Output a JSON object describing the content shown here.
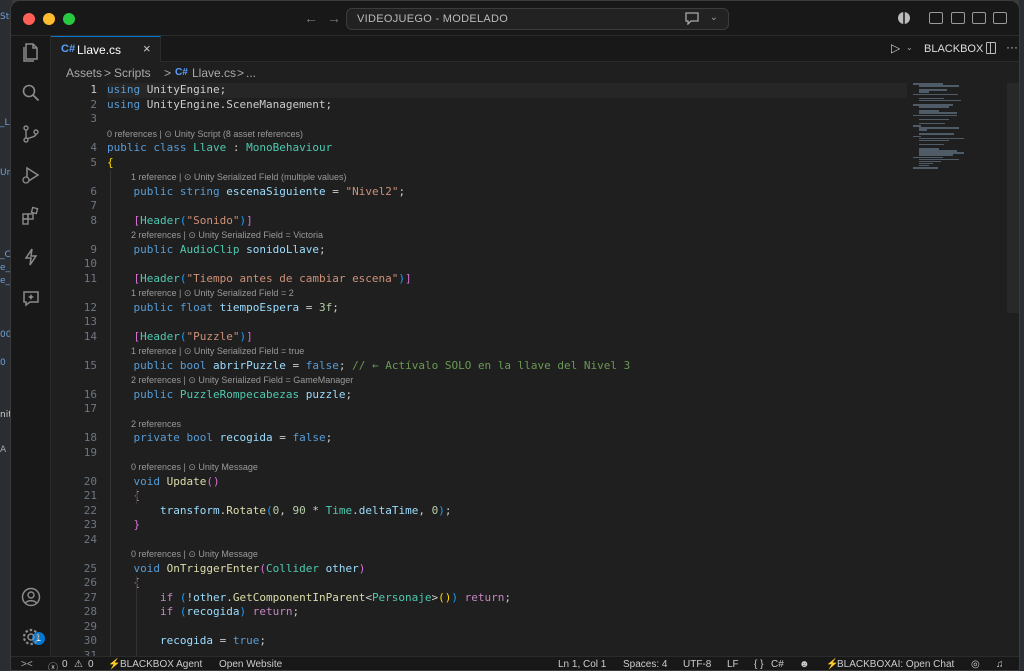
{
  "window": {
    "title": "VIDEOJUEGO - MODELADO",
    "bg_fragments": [
      "Ste",
      "_L",
      "Un",
      "_C",
      "e_1",
      "e_1",
      "00",
      "0",
      "nit",
      "A"
    ]
  },
  "tabs": [
    {
      "label": "Llave.cs",
      "icon": "C#",
      "close": "×"
    }
  ],
  "toolbar": {
    "blackbox_label": "BLACKBOX",
    "more": "···"
  },
  "breadcrumb": {
    "items": [
      "Assets",
      "Scripts",
      "Llave.cs",
      "..."
    ],
    "separator": ">",
    "file_icon": "C#"
  },
  "editor": {
    "lines": [
      {
        "n": "1",
        "html": "<span class=\"kw\">using</span> UnityEngine;"
      },
      {
        "n": "2",
        "html": "<span class=\"kw\">using</span> UnityEngine.SceneManagement;"
      },
      {
        "n": "3",
        "html": ""
      },
      {
        "lens": "0 references | ⊙ Unity Script (8 asset references)",
        "indent": 0
      },
      {
        "n": "4",
        "html": "<span class=\"kw\">public</span> <span class=\"kw\">class</span> <span class=\"ty\">Llave</span> : <span class=\"ty\">MonoBehaviour</span>"
      },
      {
        "n": "5",
        "html": "<span class=\"br1\">{</span>"
      },
      {
        "lens": "1 reference | ⊙ Unity Serialized Field (multiple values)",
        "indent": 1
      },
      {
        "n": "6",
        "html": "    <span class=\"kw\">public</span> <span class=\"kw\">string</span> <span class=\"var\">escenaSiguiente</span> = <span class=\"str\">\"Nivel2\"</span>;"
      },
      {
        "n": "7",
        "html": ""
      },
      {
        "n": "8",
        "html": "    <span class=\"br2\">[</span><span class=\"ty\">Header</span><span class=\"br3\">(</span><span class=\"str\">\"Sonido\"</span><span class=\"br3\">)</span><span class=\"br2\">]</span>"
      },
      {
        "lens": "2 references | ⊙ Unity Serialized Field = Victoria",
        "indent": 1
      },
      {
        "n": "9",
        "html": "    <span class=\"kw\">public</span> <span class=\"ty\">AudioClip</span> <span class=\"var\">sonidoLlave</span>;"
      },
      {
        "n": "10",
        "html": ""
      },
      {
        "n": "11",
        "html": "    <span class=\"br2\">[</span><span class=\"ty\">Header</span><span class=\"br3\">(</span><span class=\"str\">\"Tiempo antes de cambiar escena\"</span><span class=\"br3\">)</span><span class=\"br2\">]</span>"
      },
      {
        "lens": "1 reference | ⊙ Unity Serialized Field = 2",
        "indent": 1
      },
      {
        "n": "12",
        "html": "    <span class=\"kw\">public</span> <span class=\"kw\">float</span> <span class=\"var\">tiempoEspera</span> = <span class=\"num\">3f</span>;"
      },
      {
        "n": "13",
        "html": ""
      },
      {
        "n": "14",
        "html": "    <span class=\"br2\">[</span><span class=\"ty\">Header</span><span class=\"br3\">(</span><span class=\"str\">\"Puzzle\"</span><span class=\"br3\">)</span><span class=\"br2\">]</span>"
      },
      {
        "lens": "1 reference | ⊙ Unity Serialized Field = true",
        "indent": 1
      },
      {
        "n": "15",
        "html": "    <span class=\"kw\">public</span> <span class=\"kw\">bool</span> <span class=\"var\">abrirPuzzle</span> = <span class=\"kw\">false</span>; <span class=\"cmt\">// ← Actívalo SOLO en la llave del Nivel 3</span>"
      },
      {
        "lens": "2 references | ⊙ Unity Serialized Field = GameManager",
        "indent": 1
      },
      {
        "n": "16",
        "html": "    <span class=\"kw\">public</span> <span class=\"ty\">PuzzleRompecabezas</span> <span class=\"var\">puzzle</span>;"
      },
      {
        "n": "17",
        "html": ""
      },
      {
        "lens": "2 references",
        "indent": 1
      },
      {
        "n": "18",
        "html": "    <span class=\"kw\">private</span> <span class=\"kw\">bool</span> <span class=\"var\">recogida</span> = <span class=\"kw\">false</span>;"
      },
      {
        "n": "19",
        "html": ""
      },
      {
        "lens": "0 references | ⊙ Unity Message",
        "indent": 1
      },
      {
        "n": "20",
        "html": "    <span class=\"kw\">void</span> <span class=\"fn\">Update</span><span class=\"br2\">()</span>"
      },
      {
        "n": "21",
        "html": "    <span class=\"br2\">{</span>"
      },
      {
        "n": "22",
        "html": "        <span class=\"var\">transform</span>.<span class=\"fn\">Rotate</span><span class=\"br3\">(</span><span class=\"num\">0</span>, <span class=\"num\">90</span> * <span class=\"ty\">Time</span>.<span class=\"var\">deltaTime</span>, <span class=\"num\">0</span><span class=\"br3\">)</span>;"
      },
      {
        "n": "23",
        "html": "    <span class=\"br2\">}</span>"
      },
      {
        "n": "24",
        "html": ""
      },
      {
        "lens": "0 references | ⊙ Unity Message",
        "indent": 1
      },
      {
        "n": "25",
        "html": "    <span class=\"kw\">void</span> <span class=\"fn\">OnTriggerEnter</span><span class=\"br2\">(</span><span class=\"ty\">Collider</span> <span class=\"var\">other</span><span class=\"br2\">)</span>"
      },
      {
        "n": "26",
        "html": "    <span class=\"br2\">{</span>"
      },
      {
        "n": "27",
        "html": "        <span class=\"ctl\">if</span> <span class=\"br3\">(</span>!<span class=\"var\">other</span>.<span class=\"fn\">GetComponentInParent</span>&lt;<span class=\"ty\">Personaje</span>&gt;<span class=\"br1\">()</span><span class=\"br3\">)</span> <span class=\"ctl\">return</span>;"
      },
      {
        "n": "28",
        "html": "        <span class=\"ctl\">if</span> <span class=\"br3\">(</span><span class=\"var\">recogida</span><span class=\"br3\">)</span> <span class=\"ctl\">return</span>;"
      },
      {
        "n": "29",
        "html": ""
      },
      {
        "n": "30",
        "html": "        <span class=\"var\">recogida</span> = <span class=\"kw\">true</span>;"
      },
      {
        "n": "31",
        "html": ""
      }
    ]
  },
  "activity": {
    "items": [
      "explorer-icon",
      "search-icon",
      "source-control-icon",
      "run-debug-icon",
      "extensions-icon",
      "blackbox-bolt-icon",
      "chat-sparkle-icon",
      "account-icon",
      "settings-gear-icon"
    ],
    "account_badge": "1"
  },
  "statusbar": {
    "remote": "><",
    "errors": "0",
    "warnings": "0",
    "blackbox_agent": "BLACKBOX Agent",
    "open_website": "Open Website",
    "position": "Ln 1, Col 1",
    "spaces": "Spaces: 4",
    "encoding": "UTF-8",
    "eol": "LF",
    "language": "C#",
    "blackbox_chat": "BLACKBOXAI: Open Chat"
  },
  "colors": {
    "accent": "#0078d4",
    "keyword": "#569cd6",
    "type": "#4ec9b0",
    "string": "#ce9178",
    "comment": "#6a9955"
  }
}
